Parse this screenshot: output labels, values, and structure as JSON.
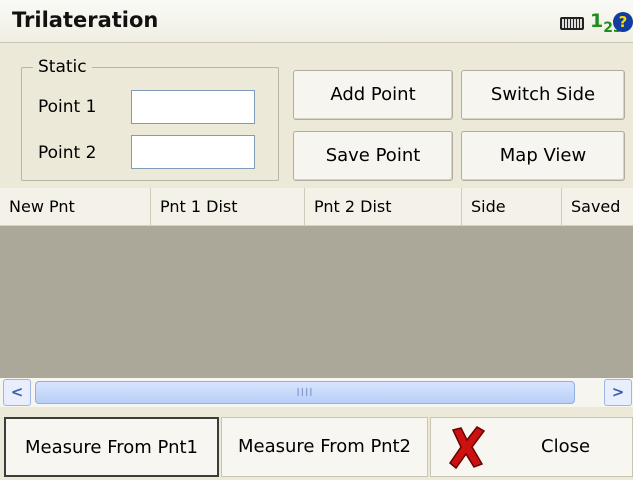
{
  "window": {
    "title": "Trilateration"
  },
  "status_icons": {
    "keyboard": "keyboard-icon",
    "input_mode": "1",
    "input_mode_sub": "23",
    "help": "?"
  },
  "static_group": {
    "label": "Static",
    "point1_label": "Point 1",
    "point1_value": "",
    "point2_label": "Point 2",
    "point2_value": ""
  },
  "buttons": {
    "add_point": "Add Point",
    "switch_side": "Switch Side",
    "save_point": "Save Point",
    "map_view": "Map View"
  },
  "table": {
    "columns": [
      "New Pnt",
      "Pnt 1 Dist",
      "Pnt 2 Dist",
      "Side",
      "Saved"
    ],
    "rows": []
  },
  "scrollbar": {
    "left": "<",
    "right": ">",
    "grip": "IIII"
  },
  "bottom_bar": {
    "measure_pnt1": "Measure From Pnt1",
    "measure_pnt2": "Measure From Pnt2",
    "close": "Close"
  },
  "colors": {
    "accent_red": "#cc1111",
    "help_blue": "#0f3c9f",
    "input_green": "#1a8f1a"
  }
}
